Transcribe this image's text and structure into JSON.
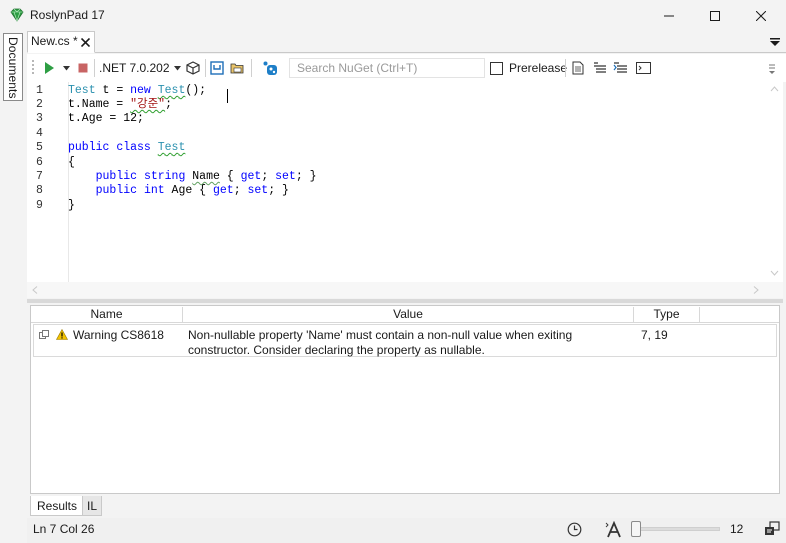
{
  "window": {
    "title": "RoslynPad 17"
  },
  "sidebar": {
    "documents_label": "Documents"
  },
  "tabs": [
    {
      "label": "New.cs *"
    }
  ],
  "toolbar": {
    "runtime": ".NET 7.0.202",
    "search_placeholder": "Search NuGet (Ctrl+T)",
    "prerelease_label": "Prerelease"
  },
  "editor": {
    "line_numbers": [
      "1",
      "2",
      "3",
      "4",
      "5",
      "6",
      "7",
      "8",
      "9"
    ]
  },
  "results": {
    "columns": [
      "Name",
      "Value",
      "Type"
    ],
    "rows": [
      {
        "name": "Warning CS8618",
        "value_line1": "Non-nullable property 'Name' must contain a non-null value when exiting",
        "value_line2": "constructor. Consider declaring the property as nullable.",
        "type": "7, 19"
      }
    ]
  },
  "bottom_tabs": [
    "Results",
    "IL"
  ],
  "status": {
    "position": "Ln 7 Col 26",
    "zoom": "12"
  },
  "colors": {
    "keyword": "#0000ff",
    "type": "#2b91af",
    "string": "#a31515",
    "run": "#2e9e44",
    "stop": "#c86464"
  }
}
